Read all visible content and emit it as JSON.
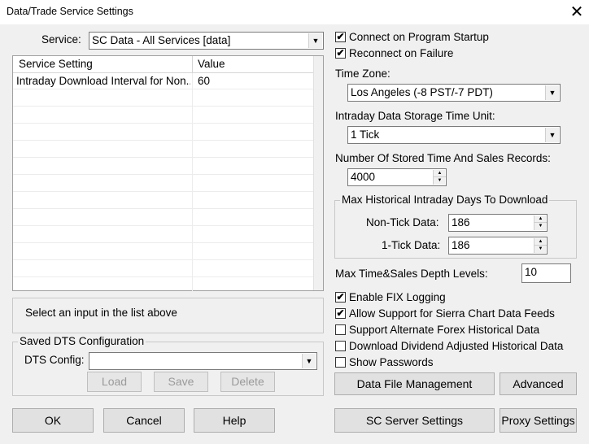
{
  "window": {
    "title": "Data/Trade Service Settings",
    "close_glyph": "✕"
  },
  "service": {
    "label": "Service:",
    "selected": "SC Data - All Services    [data]"
  },
  "settings_table": {
    "columns": [
      "Service Setting",
      "Value"
    ],
    "rows": [
      {
        "setting": "Intraday Download Interval for Non...",
        "value": "60"
      }
    ]
  },
  "info_text": "Select an input in the list above",
  "saved_dts": {
    "title": "Saved DTS Configuration",
    "config_label": "DTS Config:",
    "config_value": "",
    "load_label": "Load",
    "save_label": "Save",
    "delete_label": "Delete"
  },
  "right": {
    "connect_on_startup": {
      "label": "Connect on Program Startup",
      "checked": true
    },
    "reconnect_on_failure": {
      "label": "Reconnect on Failure",
      "checked": true
    },
    "time_zone": {
      "label": "Time Zone:",
      "selected": "Los Angeles (-8 PST/-7 PDT)"
    },
    "storage_unit": {
      "label": "Intraday Data Storage Time Unit:",
      "selected": "1 Tick"
    },
    "stored_records": {
      "label": "Number Of Stored Time And Sales Records:",
      "value": "4000"
    },
    "max_days": {
      "title": "Max Historical Intraday Days To Download",
      "non_tick_label": "Non-Tick Data:",
      "non_tick_value": "186",
      "one_tick_label": "1-Tick Data:",
      "one_tick_value": "186"
    },
    "depth_levels": {
      "label": "Max Time&Sales Depth Levels:",
      "value": "10"
    },
    "enable_fix_logging": {
      "label": "Enable FIX Logging",
      "checked": true
    },
    "allow_sierra_feeds": {
      "label": "Allow Support for Sierra Chart Data Feeds",
      "checked": true
    },
    "alt_forex": {
      "label": "Support Alternate Forex Historical Data",
      "checked": false
    },
    "dividend_adjusted": {
      "label": "Download Dividend Adjusted Historical Data",
      "checked": false
    },
    "show_passwords": {
      "label": "Show Passwords",
      "checked": false
    }
  },
  "buttons": {
    "data_file_management": "Data File Management",
    "advanced": "Advanced",
    "ok": "OK",
    "cancel": "Cancel",
    "help": "Help",
    "sc_server_settings": "SC Server Settings",
    "proxy_settings": "Proxy Settings"
  },
  "check_glyph": "✔",
  "dropdown_glyph": "▼",
  "spin_up_glyph": "▲",
  "spin_down_glyph": "▼"
}
